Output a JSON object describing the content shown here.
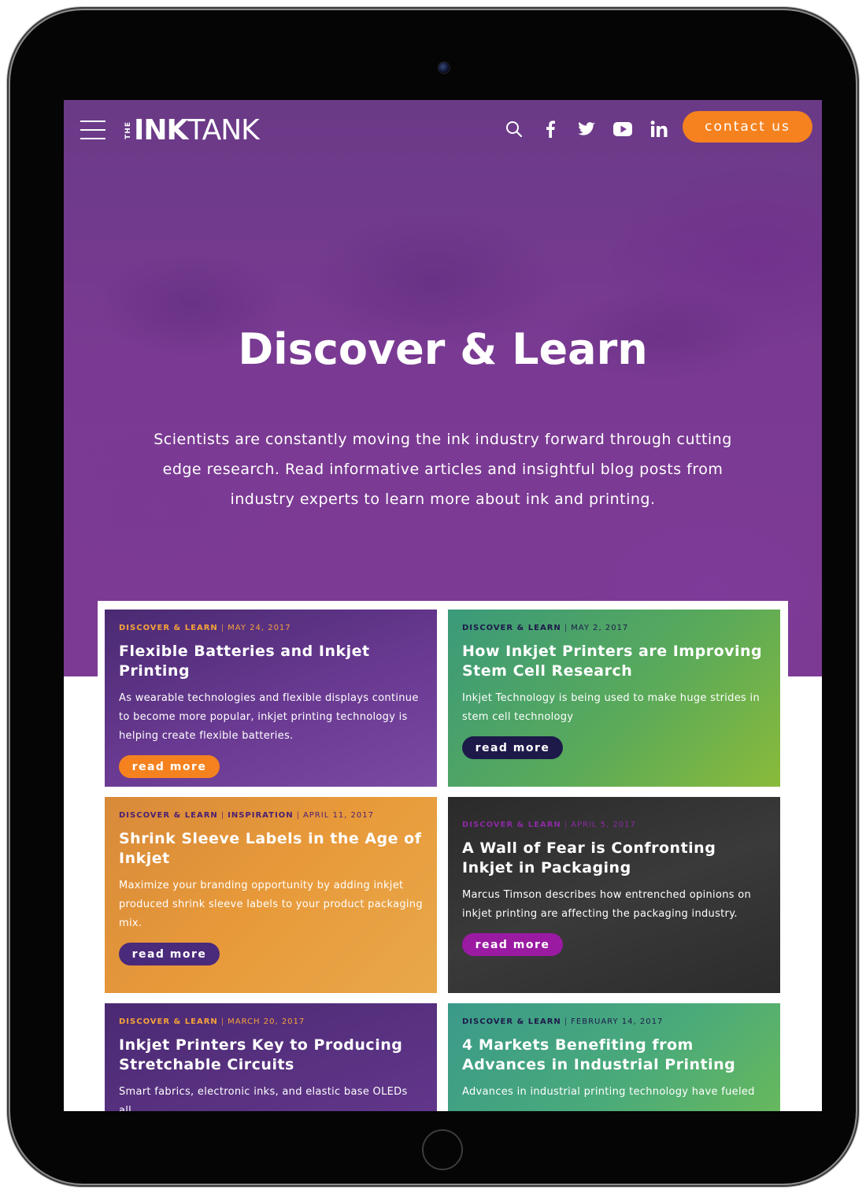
{
  "header": {
    "logo_the": "THE",
    "logo_ink": "INK",
    "logo_tank": "TANK",
    "contact_label": "contact us",
    "icons": [
      "menu-icon",
      "search-icon",
      "facebook-icon",
      "twitter-icon",
      "youtube-icon",
      "linkedin-icon"
    ]
  },
  "hero": {
    "title": "Discover & Learn",
    "text": "Scientists are constantly moving the ink industry forward through cutting edge research. Read informative articles and insightful blog posts from industry experts to learn more about ink and printing."
  },
  "colors": {
    "brand_purple": "#7d3a94",
    "brand_orange": "#f5821f",
    "navy": "#1d1a4a"
  },
  "cards": [
    {
      "categories": [
        "DISCOVER & LEARN"
      ],
      "date": "MAY 24, 2017",
      "title": "Flexible Batteries and Inkjet Printing",
      "excerpt": "As wearable technologies and flexible displays continue to become more popular, inkjet printing technology is helping create flexible batteries.",
      "button": "read more"
    },
    {
      "categories": [
        "DISCOVER & LEARN"
      ],
      "date": "MAY 2, 2017",
      "title": "How Inkjet Printers are Improving Stem Cell Research",
      "excerpt": "Inkjet Technology is being used to make huge strides in stem cell technology",
      "button": "read more"
    },
    {
      "categories": [
        "DISCOVER & LEARN",
        "INSPIRATION"
      ],
      "date": "APRIL 11, 2017",
      "title": "Shrink Sleeve Labels in the Age of Inkjet",
      "excerpt": "Maximize your branding opportunity by adding inkjet produced shrink sleeve labels to your product packaging mix.",
      "button": "read more"
    },
    {
      "categories": [
        "DISCOVER & LEARN"
      ],
      "date": "APRIL 5, 2017",
      "title": "A Wall of Fear is Confronting Inkjet in Packaging",
      "excerpt": "Marcus Timson describes how entrenched opinions on inkjet printing are affecting the packaging industry.",
      "button": "read more"
    },
    {
      "categories": [
        "DISCOVER & LEARN"
      ],
      "date": "MARCH 20, 2017",
      "title": "Inkjet Printers Key to Producing Stretchable Circuits",
      "excerpt": "Smart fabrics, electronic inks, and elastic base OLEDs all"
    },
    {
      "categories": [
        "DISCOVER & LEARN"
      ],
      "date": "FEBRUARY 14, 2017",
      "title": "4 Markets Benefiting from Advances in Industrial Printing",
      "excerpt": "Advances in industrial printing technology have fueled"
    }
  ]
}
